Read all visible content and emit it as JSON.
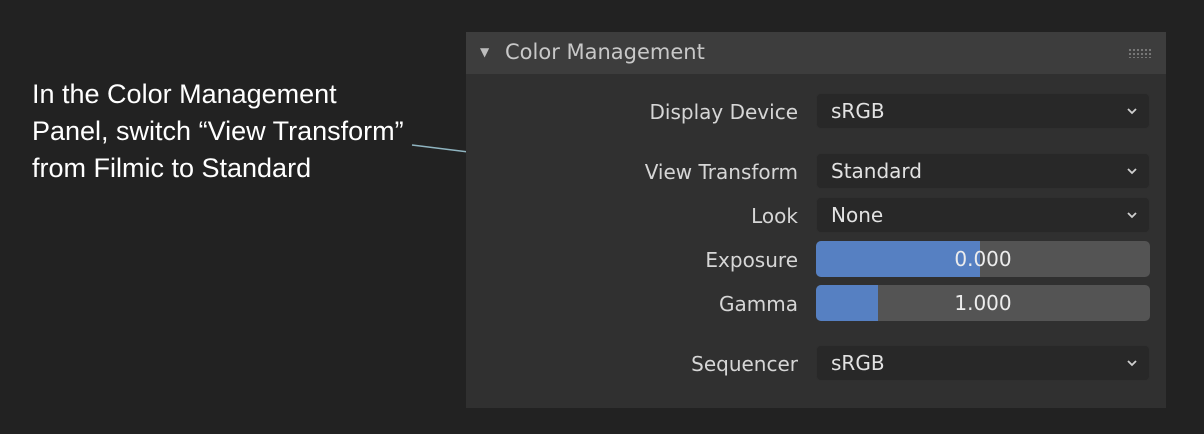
{
  "annotation": {
    "text": "In the Color Management Panel, switch “View Transform” from Filmic to Standard"
  },
  "panel": {
    "title": "Color Management",
    "collapse_icon": "triangle-down-icon",
    "grip_icon": "drag-grip-icon",
    "display_device": {
      "label": "Display Device",
      "value": "sRGB"
    },
    "view_transform": {
      "label": "View Transform",
      "value": "Standard"
    },
    "look": {
      "label": "Look",
      "value": "None"
    },
    "exposure": {
      "label": "Exposure",
      "value": "0.000",
      "fill_fraction": 0.49
    },
    "gamma": {
      "label": "Gamma",
      "value": "1.000",
      "fill_fraction": 0.185
    },
    "sequencer": {
      "label": "Sequencer",
      "value": "sRGB"
    }
  },
  "colors": {
    "background": "#222222",
    "panel": "#303030",
    "header": "#3d3d3d",
    "dropdown": "#282828",
    "slider_track": "#545454",
    "slider_fill": "#5680c2",
    "leader_line": "#8fb4c0"
  }
}
